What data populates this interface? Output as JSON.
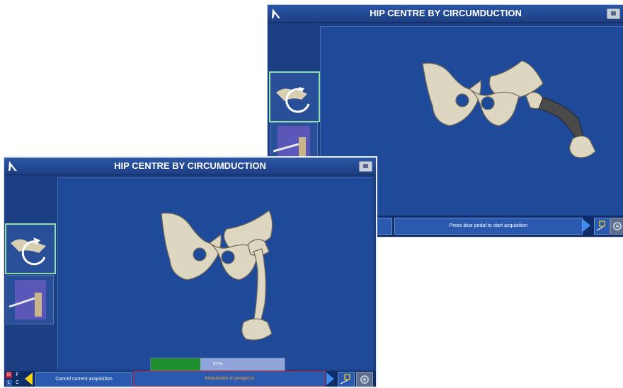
{
  "back_window": {
    "title": "HIP CENTRE BY CIRCUMDUCTION",
    "status": "Press blue pedal to start acquisition"
  },
  "front_window": {
    "title": "HIP CENTRE BY CIRCUMDUCTION",
    "cancel_label": "Cancel current acquisition",
    "status": "Acquisition in progress",
    "progress_percent": 37,
    "progress_label": "37%",
    "side_letters": [
      "R",
      "F",
      "L",
      "C"
    ]
  },
  "colors": {
    "background_blue": "#1c3f83",
    "active_step_border": "#8ee0a8",
    "progress_fill": "#1f8f2d",
    "status_text_orange": "#f4a531",
    "status_highlight_border": "#c4243a"
  },
  "icons": [
    "logo-icon",
    "camera-icon",
    "circumduction-icon",
    "leg-probe-icon",
    "arrow-left-icon",
    "arrow-right-icon",
    "tracker-icon",
    "gear-icon"
  ]
}
